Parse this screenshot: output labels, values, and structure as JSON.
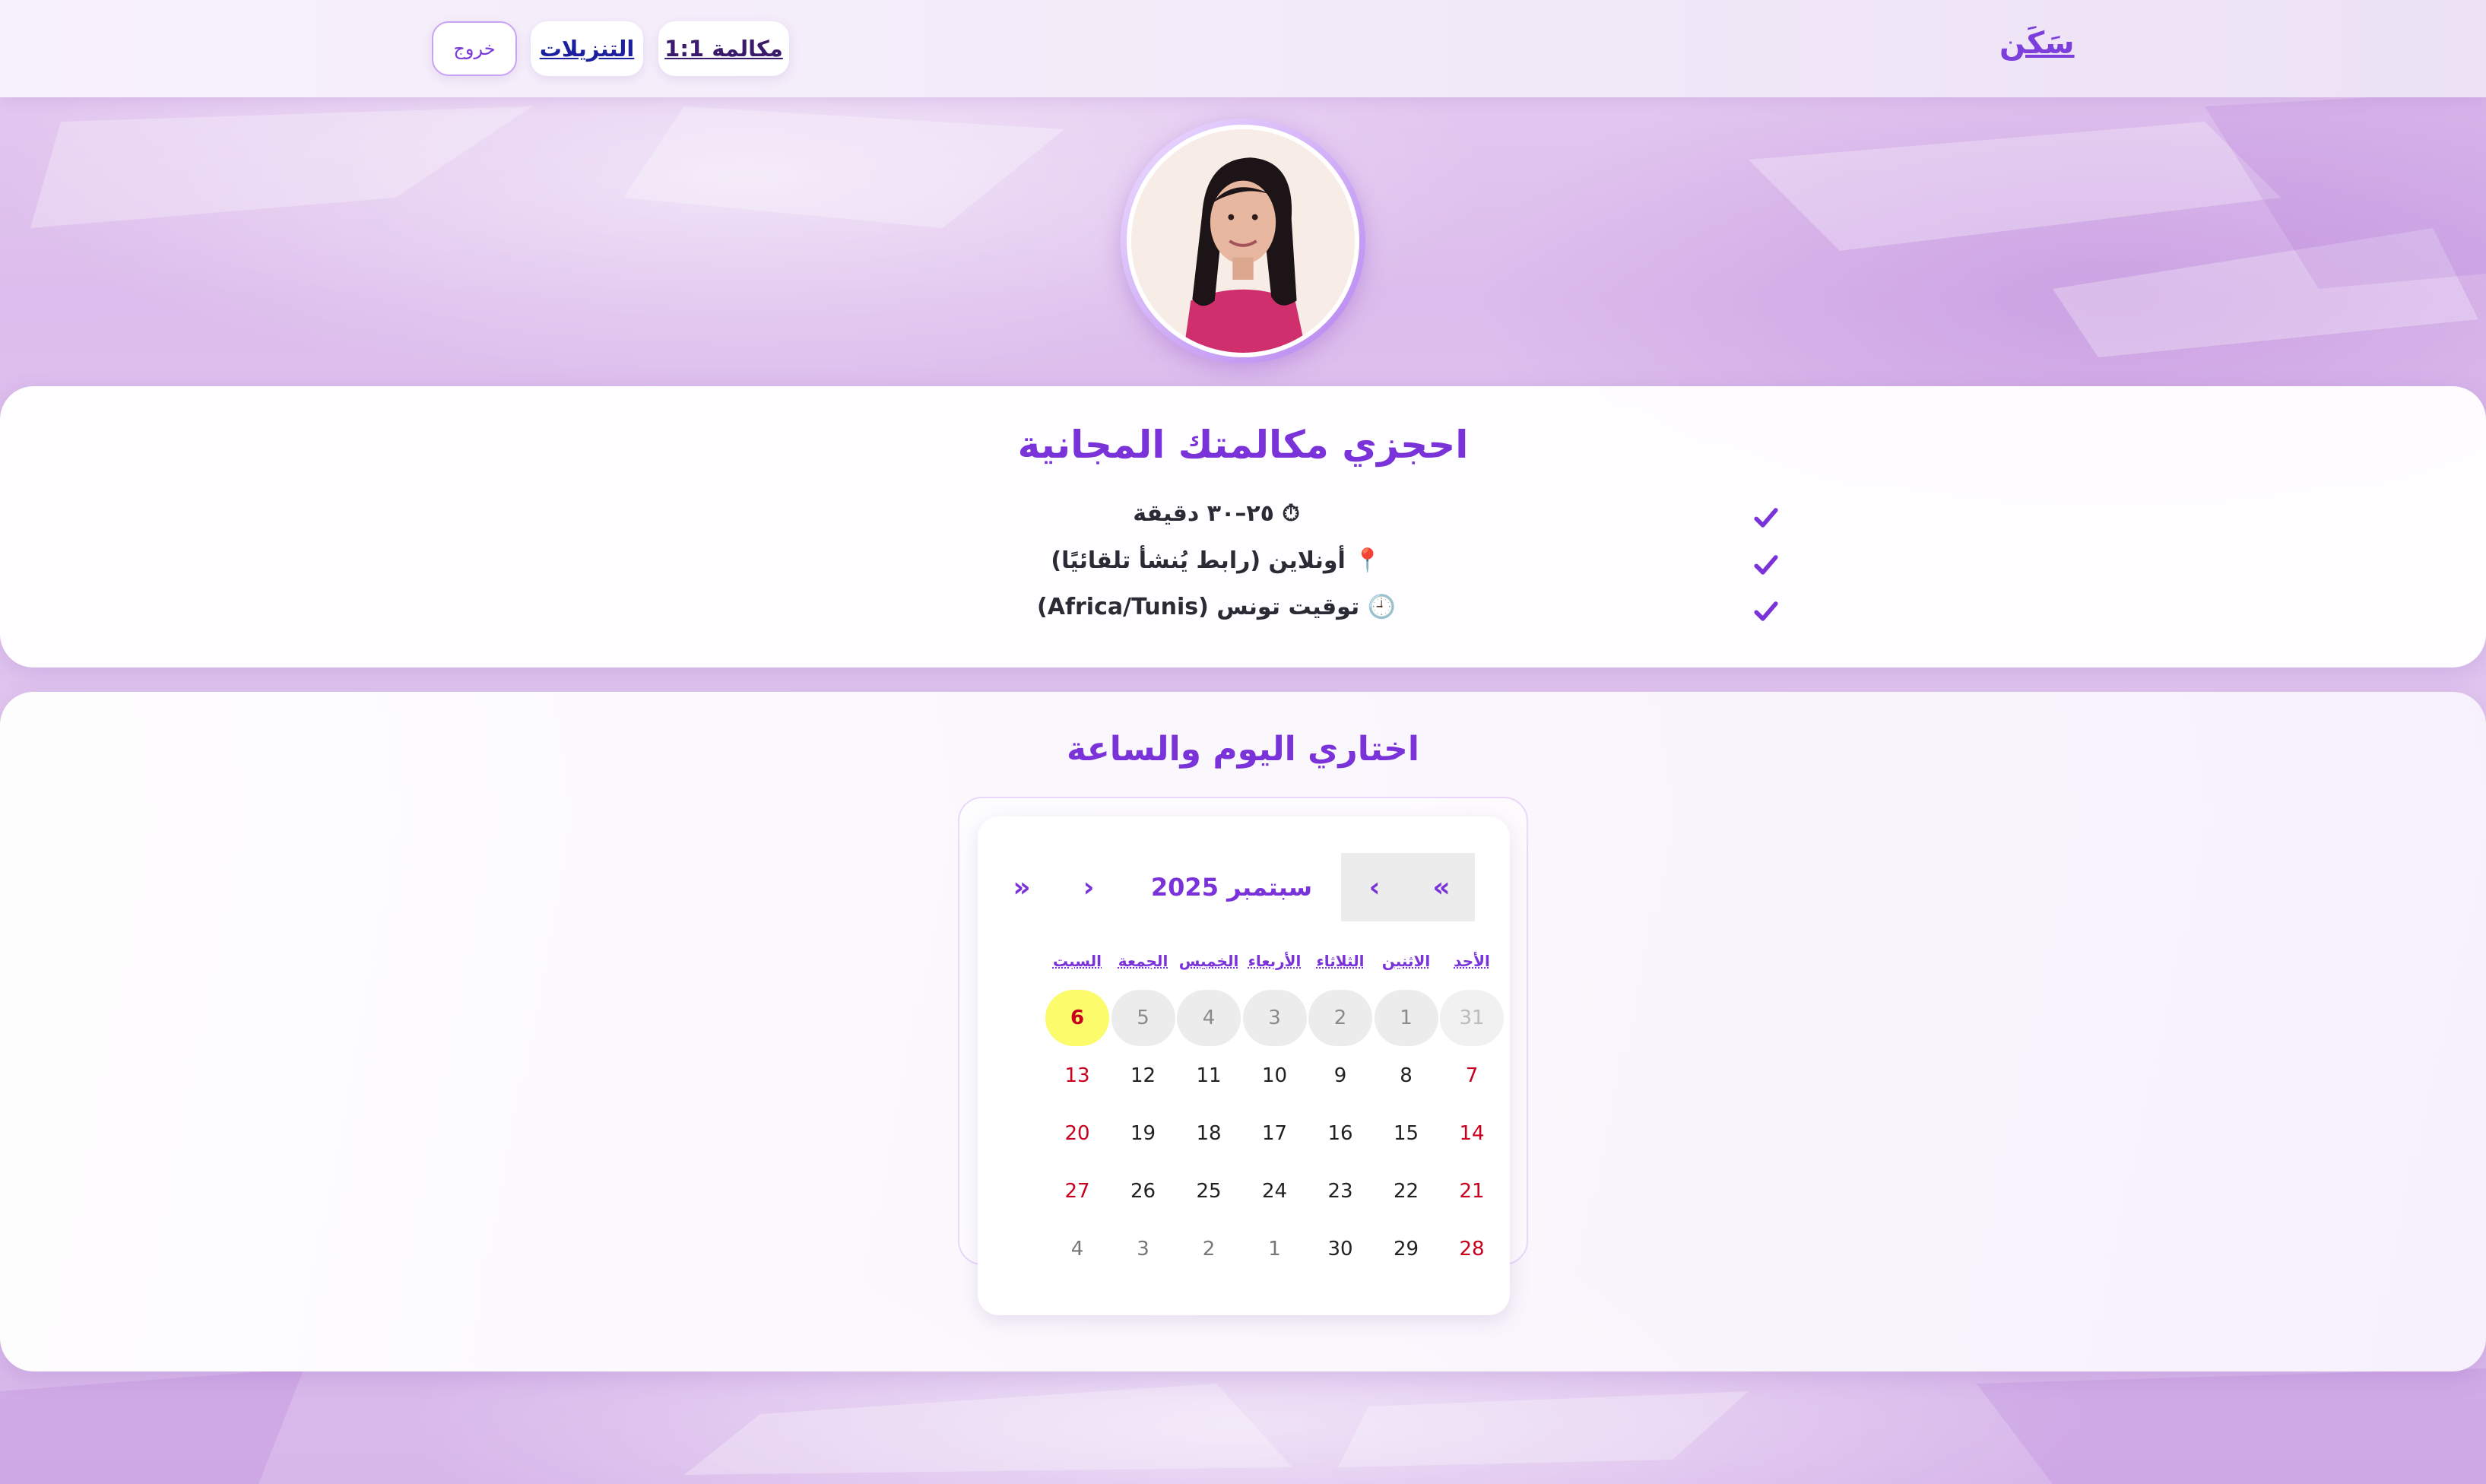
{
  "header": {
    "brand": "سَكَن",
    "nav": {
      "call_label": "مكالمة 1:1",
      "downloads_label": "التنزيلات",
      "logout_label": "خروج"
    }
  },
  "info_card": {
    "title": "احجزي مكالمتك المجانية",
    "items": [
      {
        "icon": "stopwatch-icon",
        "glyph": "⏱",
        "text": "٢٥–٣٠ دقيقة"
      },
      {
        "icon": "pin-icon",
        "glyph": "📍",
        "text": "أونلاين (رابط يُنشأ تلقائيًا)"
      },
      {
        "icon": "clock-icon",
        "glyph": "🕘",
        "text": "توقيت تونس (Africa/Tunis)"
      }
    ]
  },
  "calendar_card": {
    "title": "اختاري اليوم والساعة",
    "nav": {
      "prev_year": "«",
      "prev_month": "‹",
      "month_label": "سبتمبر 2025",
      "next_month": "›",
      "next_year": "»"
    },
    "weekdays": [
      "الأحد",
      "الاثنين",
      "الثلاثاء",
      "الأربعاء",
      "الخميس",
      "الجمعة",
      "السبت"
    ],
    "weeks": [
      [
        {
          "d": "31",
          "s": "prev-month"
        },
        {
          "d": "1",
          "s": "past"
        },
        {
          "d": "2",
          "s": "past"
        },
        {
          "d": "3",
          "s": "past"
        },
        {
          "d": "4",
          "s": "past"
        },
        {
          "d": "5",
          "s": "past"
        },
        {
          "d": "6",
          "s": "today"
        }
      ],
      [
        {
          "d": "7",
          "s": "weekend"
        },
        {
          "d": "8",
          "s": ""
        },
        {
          "d": "9",
          "s": ""
        },
        {
          "d": "10",
          "s": ""
        },
        {
          "d": "11",
          "s": ""
        },
        {
          "d": "12",
          "s": ""
        },
        {
          "d": "13",
          "s": "weekend"
        }
      ],
      [
        {
          "d": "14",
          "s": "weekend"
        },
        {
          "d": "15",
          "s": ""
        },
        {
          "d": "16",
          "s": ""
        },
        {
          "d": "17",
          "s": ""
        },
        {
          "d": "18",
          "s": ""
        },
        {
          "d": "19",
          "s": ""
        },
        {
          "d": "20",
          "s": "weekend"
        }
      ],
      [
        {
          "d": "21",
          "s": "weekend"
        },
        {
          "d": "22",
          "s": ""
        },
        {
          "d": "23",
          "s": ""
        },
        {
          "d": "24",
          "s": ""
        },
        {
          "d": "25",
          "s": ""
        },
        {
          "d": "26",
          "s": ""
        },
        {
          "d": "27",
          "s": "weekend"
        }
      ],
      [
        {
          "d": "28",
          "s": "weekend"
        },
        {
          "d": "29",
          "s": ""
        },
        {
          "d": "30",
          "s": ""
        },
        {
          "d": "1",
          "s": "other"
        },
        {
          "d": "2",
          "s": "other"
        },
        {
          "d": "3",
          "s": "other"
        },
        {
          "d": "4",
          "s": "other"
        }
      ]
    ]
  },
  "colors": {
    "accent": "#7a33d8",
    "weekend": "#c8001e",
    "today_highlight": "#fbfb6b"
  }
}
